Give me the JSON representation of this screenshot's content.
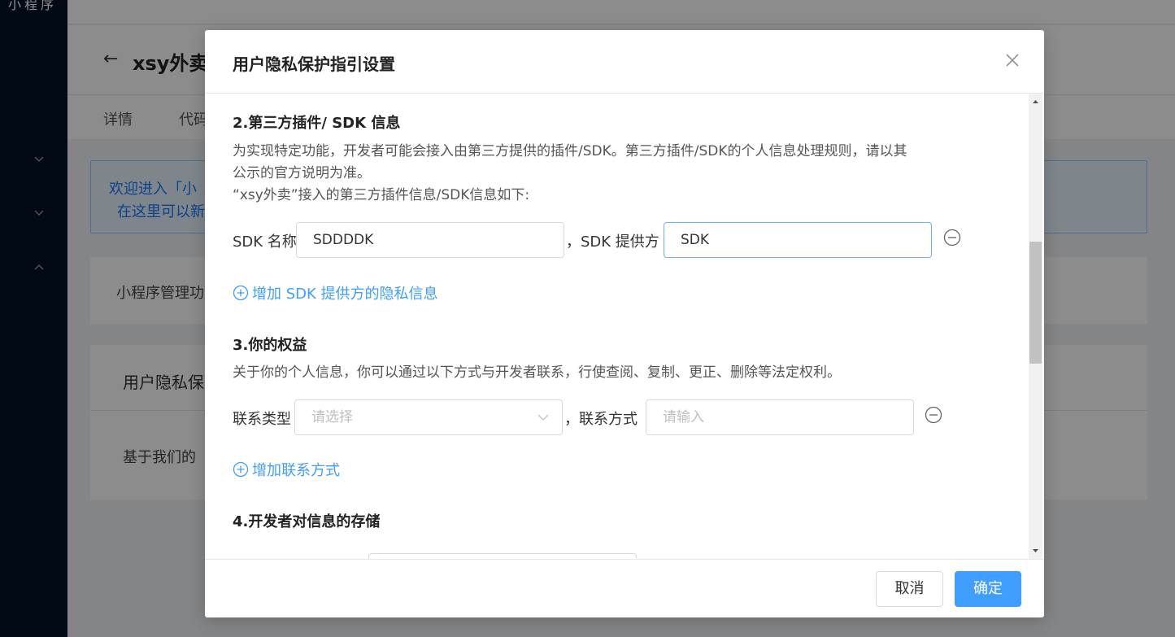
{
  "background": {
    "sidebar_top_text": "小程序",
    "app_title": "xsy外卖",
    "tabs": [
      "详情",
      "代码"
    ],
    "alert_line1": "欢迎进入「小",
    "alert_line2": "在这里可以新",
    "card1_text": "小程序管理功",
    "card2_title": "用户隐私保",
    "card2_text": "基于我们的"
  },
  "modal": {
    "title": "用户隐私保护指引设置",
    "sections": {
      "s2": {
        "title": "2.第三方插件/ SDK 信息",
        "desc_line1": "为实现特定功能，开发者可能会接入由第三方提供的插件/SDK。第三方插件/SDK的个人信息处理规则，请以其",
        "desc_line2": "公示的官方说明为准。",
        "desc_line3": "“xsy外卖”接入的第三方插件信息/SDK信息如下:",
        "sdk_name_label": "SDK 名称",
        "sdk_name_value": "SDDDDK",
        "separator": "，",
        "sdk_provider_label": "SDK 提供方",
        "sdk_provider_value": "SDK",
        "add_link": "增加 SDK 提供方的隐私信息"
      },
      "s3": {
        "title": "3.你的权益",
        "desc": "关于你的个人信息，你可以通过以下方式与开发者联系，行使查阅、复制、更正、删除等法定权利。",
        "contact_type_label": "联系类型",
        "contact_type_placeholder": "请选择",
        "separator": "，",
        "contact_method_label": "联系方式",
        "contact_method_placeholder": "请输入",
        "add_link": "增加联系方式"
      },
      "s4": {
        "title": "4.开发者对信息的存储"
      }
    },
    "footer": {
      "cancel": "取消",
      "ok": "确定"
    }
  },
  "colors": {
    "sidebar": "#001529",
    "primary": "#409eff",
    "mask": "rgba(0,0,0,0.45)"
  }
}
